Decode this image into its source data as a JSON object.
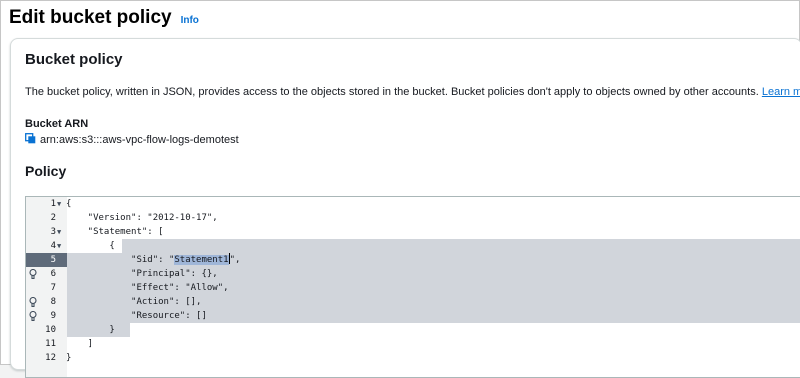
{
  "page": {
    "title": "Edit bucket policy",
    "info_label": "Info"
  },
  "panel": {
    "title": "Bucket policy",
    "description": "The bucket policy, written in JSON, provides access to the objects stored in the bucket. Bucket policies don't apply to objects owned by other accounts.",
    "learn_more": "Learn more",
    "arn_label": "Bucket ARN",
    "arn_value": "arn:aws:s3:::aws-vpc-flow-logs-demotest",
    "policy_label": "Policy"
  },
  "editor": {
    "lines": [
      {
        "num": "1",
        "text": "{"
      },
      {
        "num": "2",
        "text": "    \"Version\": \"2012-10-17\","
      },
      {
        "num": "3",
        "text": "    \"Statement\": ["
      },
      {
        "num": "4",
        "text": "        {"
      },
      {
        "num": "5",
        "pre": "            \"Sid\": \"",
        "hl": "Statement1",
        "post": "\","
      },
      {
        "num": "6",
        "text": "            \"Principal\": {},"
      },
      {
        "num": "7",
        "text": "            \"Effect\": \"Allow\","
      },
      {
        "num": "8",
        "text": "            \"Action\": [],"
      },
      {
        "num": "9",
        "text": "            \"Resource\": []"
      },
      {
        "num": "10",
        "text": "        }"
      },
      {
        "num": "11",
        "text": "    ]"
      },
      {
        "num": "12",
        "text": "}"
      }
    ]
  }
}
